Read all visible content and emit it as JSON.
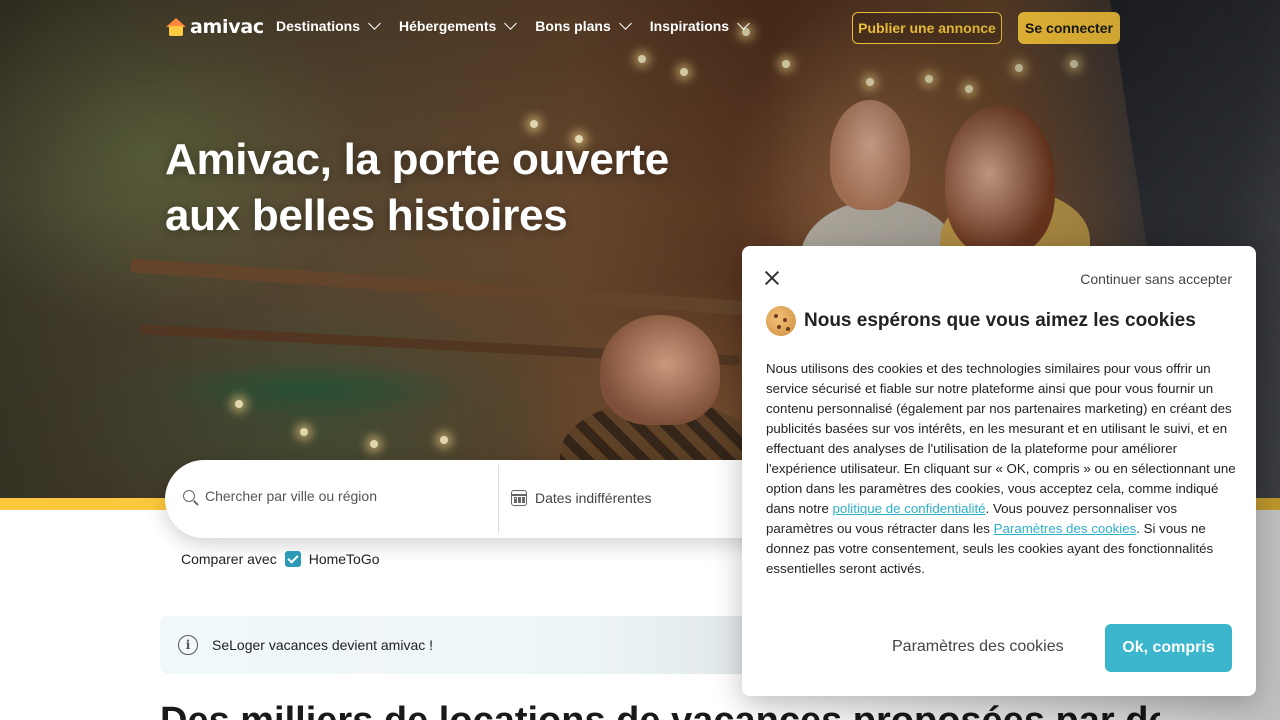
{
  "header": {
    "logo": "amivac",
    "nav": [
      {
        "label": "Destinations"
      },
      {
        "label": "Hébergements"
      },
      {
        "label": "Bons plans"
      },
      {
        "label": "Inspirations"
      }
    ],
    "publish_label": "Publier une annonce",
    "login_label": "Se connecter"
  },
  "hero": {
    "title_line1": "Amivac, la porte ouverte",
    "title_line2": "aux belles histoires"
  },
  "search": {
    "placeholder": "Chercher par ville ou région",
    "dates_label": "Dates indifférentes",
    "compare_label": "Comparer avec",
    "compare_option": "HomeToGo",
    "compare_checked": true
  },
  "banner": {
    "text": "SeLoger vacances devient amivac !"
  },
  "section": {
    "title": "Des milliers de locations de vacances proposées par des"
  },
  "cookie_dialog": {
    "continue_label": "Continuer sans accepter",
    "title": "Nous espérons que vous aimez les cookies",
    "body_part1": "Nous utilisons des cookies et des technologies similaires pour vous offrir un service sécurisé et fiable sur notre plateforme ainsi que pour vous fournir un contenu personnalisé (également par nos partenaires marketing) en créant des publicités basées sur vos intérêts, en les mesurant et en utilisant le suivi, et en effectuant des analyses de l'utilisation de la plateforme pour améliorer l'expérience utilisateur. En cliquant sur « OK, compris » ou en sélectionnant une option dans les paramètres des cookies, vous acceptez cela, comme indiqué dans notre ",
    "privacy_link": "politique de confidentialité",
    "body_part2": ". Vous pouvez personnaliser vos paramètres ou vous rétracter dans les ",
    "settings_link": "Paramètres des cookies",
    "body_part3": ". Si vous ne donnez pas votre consentement, seuls les cookies ayant des fonctionnalités essentielles seront activés.",
    "settings_button": "Paramètres des cookies",
    "ok_button": "Ok, compris"
  },
  "colors": {
    "accent_yellow": "#fcc83b",
    "accent_teal": "#3bb6cc",
    "checkbox_teal": "#2a9ab7"
  }
}
